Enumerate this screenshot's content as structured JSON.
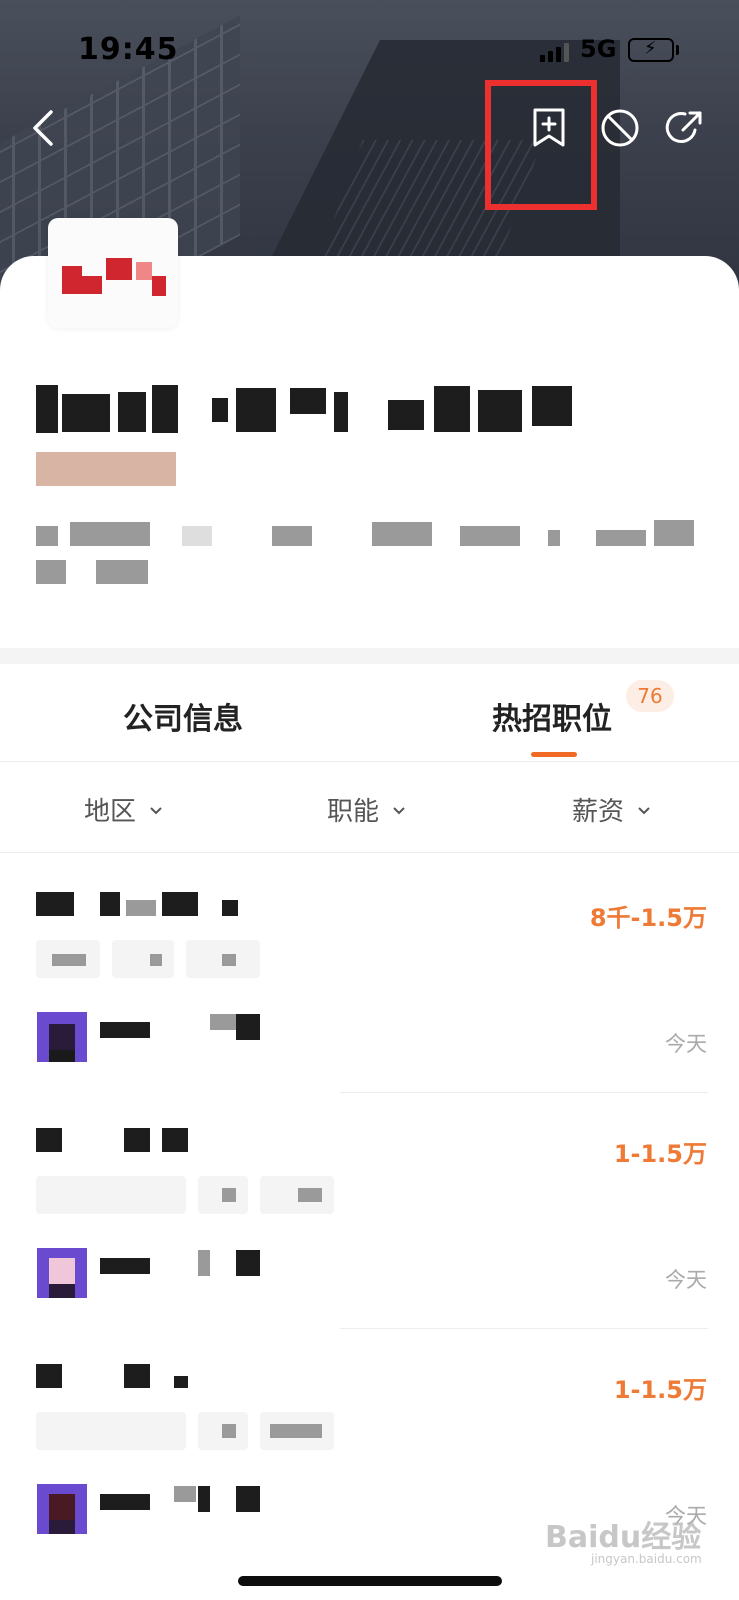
{
  "status_bar": {
    "time": "19:45",
    "network": "5G"
  },
  "tabs": {
    "company_info": "公司信息",
    "hot_jobs": "热招职位",
    "hot_jobs_count": "76"
  },
  "filters": {
    "region": "地区",
    "function": "职能",
    "salary": "薪资"
  },
  "jobs": [
    {
      "salary": "8千-1.5万",
      "date": "今天"
    },
    {
      "salary": "1-1.5万",
      "date": "今天"
    },
    {
      "salary": "1-1.5万",
      "date": "今天"
    }
  ],
  "watermark": {
    "brand": "Baidu经验",
    "url": "jingyan.baidu.com"
  },
  "colors": {
    "accent": "#ef7a35",
    "highlight_box": "#ec2f2f",
    "battery": "#34c759"
  },
  "icons": {
    "back": "chevron-left-icon",
    "bookmark": "bookmark-plus-icon",
    "block": "block-icon",
    "share": "share-icon",
    "dropdown": "chevron-down-icon"
  }
}
